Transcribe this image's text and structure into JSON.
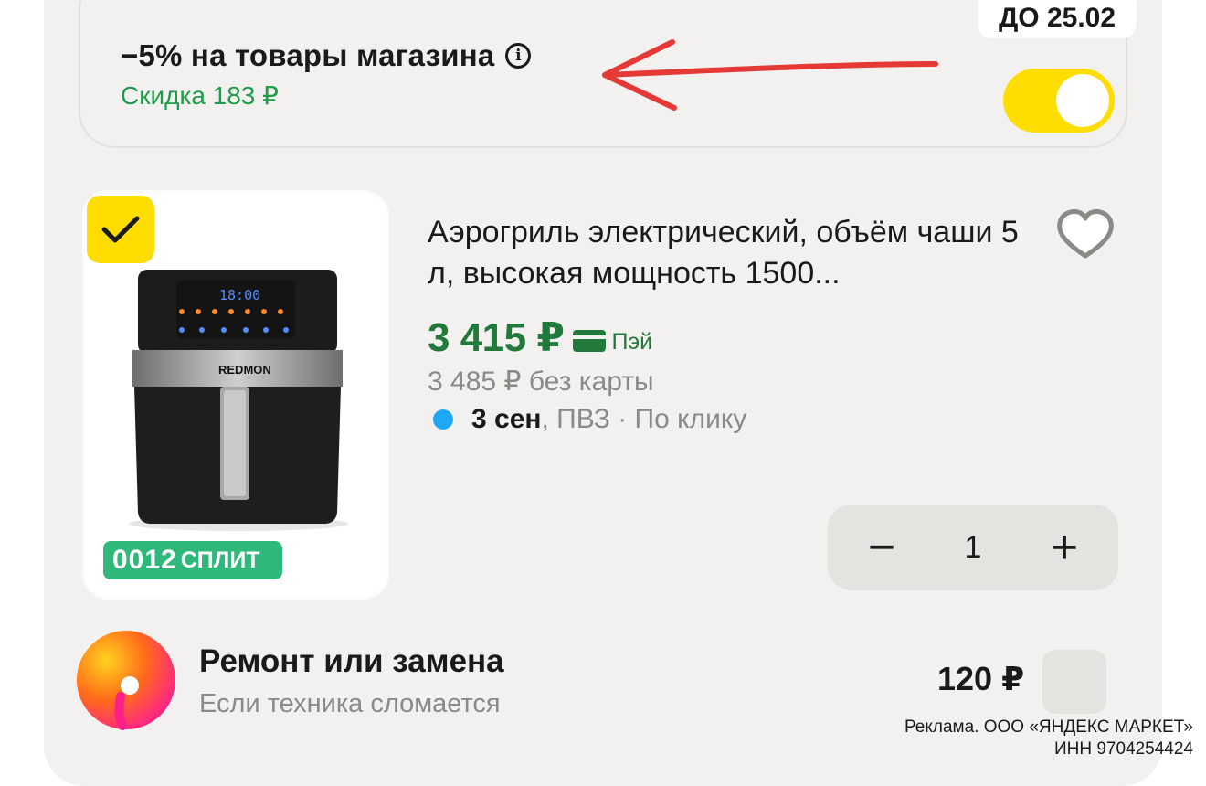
{
  "promo": {
    "title": "−5% на товары магазина",
    "info_icon": "info-icon",
    "discount": "Скидка 183 ₽",
    "deadline_badge": "ДО 25.02",
    "toggle_on": true,
    "accent_color": "#ffdd00",
    "arrow_color": "#e53935"
  },
  "product": {
    "selected": true,
    "brand_on_image": "REDMON",
    "display_time": "18:00",
    "split_badge_number": "0012",
    "split_badge_text": "СПЛИТ",
    "title": "Аэрогриль электрический, объём чаши 5 л, высокая мощность 1500...",
    "price": "3 415 ₽",
    "pay_label": "Пэй",
    "old_price": "3 485 ₽  без карты",
    "delivery_date": "3 сен",
    "delivery_rest": ", ПВЗ · По клику",
    "quantity": "1",
    "minus_label": "−",
    "plus_label": "+",
    "price_color": "#21793c"
  },
  "service": {
    "title": "Ремонт или замена",
    "subtitle": "Если техника сломается",
    "price": "120 ₽",
    "selected": false
  },
  "ad": {
    "line1": "Реклама. ООО «ЯНДЕКС МАРКЕТ»",
    "line2": "ИНН 9704254424"
  }
}
